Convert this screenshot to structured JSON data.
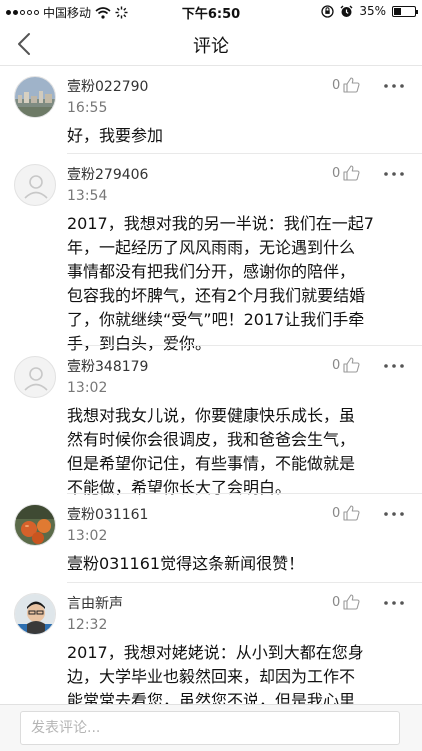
{
  "status_bar": {
    "carrier": "中国移动",
    "time": "下午6:50",
    "battery_percent": "35%",
    "battery_level": 0.35,
    "icons": [
      "signal-icon",
      "wifi-icon",
      "loading-icon",
      "rotation-lock-icon",
      "alarm-icon",
      "battery-icon"
    ]
  },
  "nav": {
    "title": "评论",
    "back_icon": "chevron-left-icon"
  },
  "comments": [
    {
      "user": "壹粉022790",
      "time": "16:55",
      "text": "好，我要参加",
      "likes": "0",
      "avatar": "photo-cityscape"
    },
    {
      "user": "壹粉279406",
      "time": "13:54",
      "text": "2017，我想对我的另一半说：我们在一起7\n年，一起经历了风风雨雨，无论遇到什么\n事情都没有把我们分开，感谢你的陪伴，\n包容我的坏脾气，还有2个月我们就要结婚\n了，你就继续“受气”吧！2017让我们手牵\n手，到白头，爱你。",
      "likes": "0",
      "avatar": "default-user"
    },
    {
      "user": "壹粉348179",
      "time": "13:02",
      "text": "我想对我女儿说，你要健康快乐成长，虽\n然有时候你会很调皮，我和爸爸会生气，\n但是希望你记住，有些事情，不能做就是\n不能做，希望你长大了会明白。",
      "likes": "0",
      "avatar": "default-user"
    },
    {
      "user": "壹粉031161",
      "time": "13:02",
      "text": "壹粉031161觉得这条新闻很赞！",
      "likes": "0",
      "avatar": "photo-fruit"
    },
    {
      "user": "言由新声",
      "time": "12:32",
      "text": "2017，我想对姥姥说：从小到大都在您身\n边，大学毕业也毅然回来，却因为工作不\n能常常去看您，虽然您不说，但是我心里",
      "likes": "0",
      "avatar": "photo-person"
    }
  ],
  "input": {
    "placeholder": "发表评论..."
  },
  "colors": {
    "divider": "#e9e9e9",
    "muted_text": "#777777",
    "bottom_bar": "#f7f7f7"
  }
}
